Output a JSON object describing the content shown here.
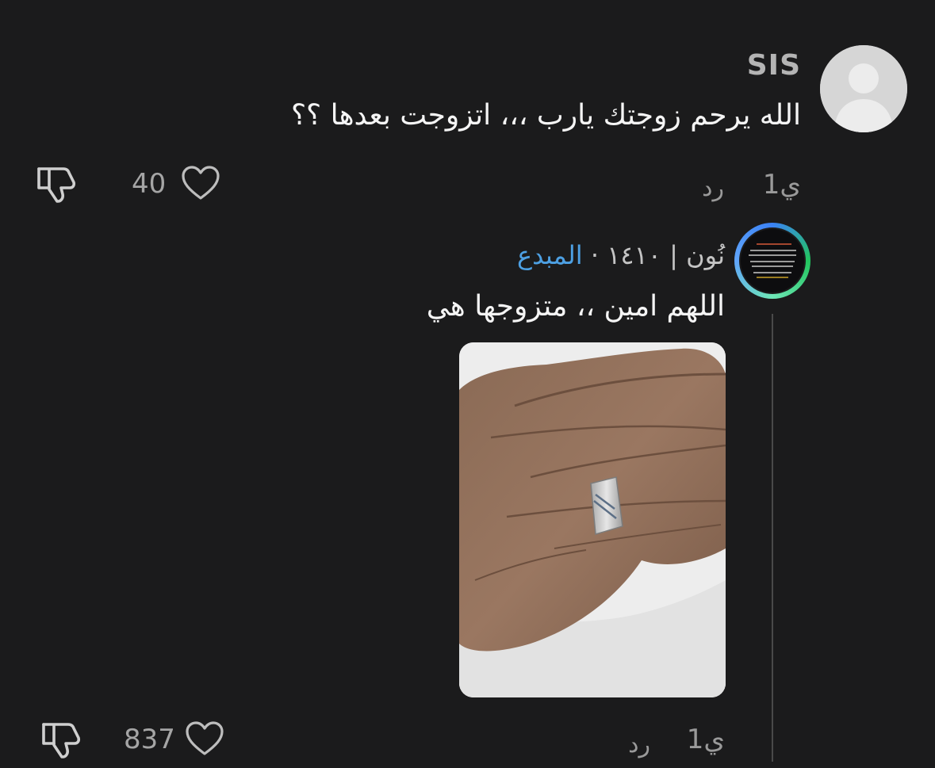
{
  "comment": {
    "username": "SIS",
    "text": "الله يرحم زوجتك يارب ،،، اتزوجت بعدها ؟؟",
    "time": "1ي",
    "reply_label": "رد",
    "likes": "40",
    "avatar_icon": "default-avatar-icon"
  },
  "reply": {
    "name": "نُون | ١٤١٠ ·",
    "badge": "المبدع",
    "text": "اللهم امين ،، متزوجها هي",
    "time": "1ي",
    "reply_label": "رد",
    "likes": "837",
    "badge_color": "#4da0e3",
    "photo_description_icon": "hand-with-ring-photo"
  },
  "icons": {
    "like": "heart-icon",
    "dislike": "thumbs-down-icon"
  }
}
